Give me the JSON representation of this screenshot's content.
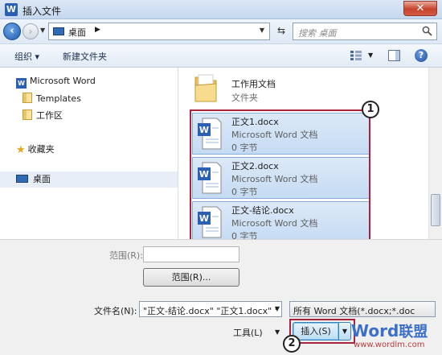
{
  "window": {
    "title": "插入文件",
    "app_icon": "word-icon"
  },
  "address": {
    "location": "桌面",
    "search_placeholder": "搜索 桌面"
  },
  "toolbar": {
    "organize": "组织 ▾",
    "new_folder": "新建文件夹"
  },
  "nav": {
    "items": [
      {
        "label": "Microsoft Word",
        "icon": "word-icon"
      },
      {
        "label": "Templates",
        "icon": "folder-icon"
      },
      {
        "label": "工作区",
        "icon": "folder-icon"
      },
      {
        "label": "收藏夹",
        "icon": "star-icon"
      },
      {
        "label": "桌面",
        "icon": "computer-icon"
      }
    ]
  },
  "files": {
    "folder": {
      "name": "工作用文档",
      "type": "文件夹"
    },
    "docs": [
      {
        "name": "正文1.docx",
        "type": "Microsoft Word 文档",
        "size": "0 字节"
      },
      {
        "name": "正文2.docx",
        "type": "Microsoft Word 文档",
        "size": "0 字节"
      },
      {
        "name": "正文-结论.docx",
        "type": "Microsoft Word 文档",
        "size": "0 字节"
      }
    ]
  },
  "callouts": {
    "one": "1",
    "two": "2"
  },
  "bottom": {
    "range_label": "范围(R):",
    "range_button": "范围(R)...",
    "filename_label": "文件名(N):",
    "filename_value": "\"正文-结论.docx\" \"正文1.docx\" \"",
    "filetype_value": "所有 Word 文档(*.docx;*.doc",
    "tools": "工具(L)",
    "insert": "插入(S)"
  },
  "brand": {
    "word": "Word",
    "cn": "联盟",
    "url": "www.wordlm.com"
  },
  "colors": {
    "accent": "#a8233b",
    "selection": "#c5dbf3",
    "titlebar": "#c6d8ef"
  }
}
